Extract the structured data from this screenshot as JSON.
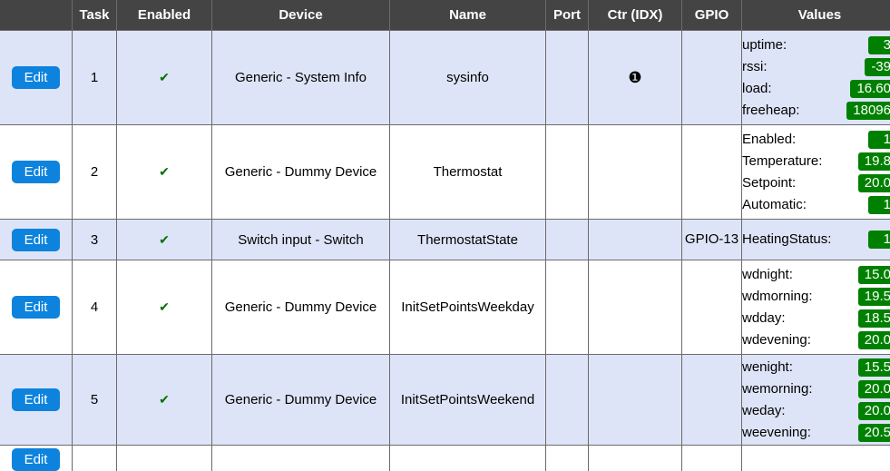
{
  "table": {
    "headers": {
      "edit": "",
      "task": "Task",
      "enabled": "Enabled",
      "device": "Device",
      "name": "Name",
      "port": "Port",
      "ctr": "Ctr (IDX)",
      "gpio": "GPIO",
      "values": "Values"
    },
    "edit_label": "Edit",
    "enabled_icon": "✔",
    "colors": {
      "header_bg": "#444444",
      "row_alt_bg": "#dee4f7",
      "row_bg": "#ffffff",
      "edit_button_bg": "#0d83dd",
      "badge_bg": "#008000",
      "check_color": "#007000",
      "border": "#6b6b6b"
    },
    "rows": [
      {
        "task": "1",
        "enabled": "✔",
        "device": "Generic - System Info",
        "name": "sysinfo",
        "port": "",
        "ctr": "❶",
        "gpio": "",
        "values": [
          {
            "label": "uptime:",
            "value": "3"
          },
          {
            "label": "rssi:",
            "value": "-39"
          },
          {
            "label": "load:",
            "value": "16.60"
          },
          {
            "label": "freeheap:",
            "value": "18096"
          }
        ]
      },
      {
        "task": "2",
        "enabled": "✔",
        "device": "Generic - Dummy Device",
        "name": "Thermostat",
        "port": "",
        "ctr": "",
        "gpio": "",
        "values": [
          {
            "label": "Enabled:",
            "value": "1"
          },
          {
            "label": "Temperature:",
            "value": "19.8"
          },
          {
            "label": "Setpoint:",
            "value": "20.0"
          },
          {
            "label": "Automatic:",
            "value": "1"
          }
        ]
      },
      {
        "task": "3",
        "enabled": "✔",
        "device": "Switch input - Switch",
        "name": "ThermostatState",
        "port": "",
        "ctr": "",
        "gpio": "GPIO-13",
        "values": [
          {
            "label": "HeatingStatus:",
            "value": "1"
          }
        ]
      },
      {
        "task": "4",
        "enabled": "✔",
        "device": "Generic - Dummy Device",
        "name": "InitSetPointsWeekday",
        "port": "",
        "ctr": "",
        "gpio": "",
        "values": [
          {
            "label": "wdnight:",
            "value": "15.0"
          },
          {
            "label": "wdmorning:",
            "value": "19.5"
          },
          {
            "label": "wdday:",
            "value": "18.5"
          },
          {
            "label": "wdevening:",
            "value": "20.0"
          }
        ]
      },
      {
        "task": "5",
        "enabled": "✔",
        "device": "Generic - Dummy Device",
        "name": "InitSetPointsWeekend",
        "port": "",
        "ctr": "",
        "gpio": "",
        "values": [
          {
            "label": "wenight:",
            "value": "15.5"
          },
          {
            "label": "wemorning:",
            "value": "20.0"
          },
          {
            "label": "weday:",
            "value": "20.0"
          },
          {
            "label": "weevening:",
            "value": "20.5"
          }
        ]
      },
      {
        "task": "",
        "enabled": "",
        "device": "",
        "name": "",
        "port": "",
        "ctr": "",
        "gpio": "",
        "values": []
      }
    ]
  }
}
